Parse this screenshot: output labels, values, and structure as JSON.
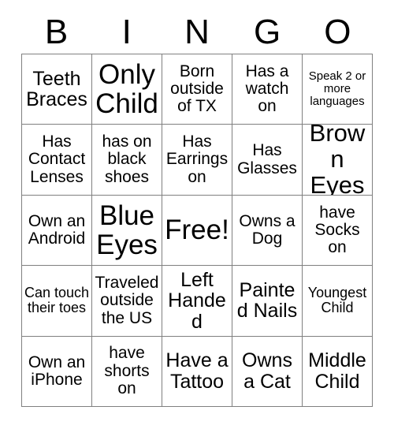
{
  "card": {
    "header_letters": [
      "B",
      "I",
      "N",
      "G",
      "O"
    ],
    "columns": 5,
    "rows": 5,
    "colors": {
      "text": "#000000",
      "grid_border": "#808080",
      "background": "#ffffff"
    },
    "cells": [
      {
        "text": "Teeth Braces",
        "size": "l",
        "row": 1,
        "col": 1
      },
      {
        "text": "Only Child",
        "size": "xxl",
        "row": 1,
        "col": 2
      },
      {
        "text": "Born outside of TX",
        "size": "m",
        "row": 1,
        "col": 3
      },
      {
        "text": "Has a watch on",
        "size": "m",
        "row": 1,
        "col": 4
      },
      {
        "text": "Speak 2 or more languages",
        "size": "xs",
        "row": 1,
        "col": 5
      },
      {
        "text": "Has Contact Lenses",
        "size": "m",
        "row": 2,
        "col": 1
      },
      {
        "text": "has on black shoes",
        "size": "m",
        "row": 2,
        "col": 2
      },
      {
        "text": "Has Earrings on",
        "size": "m",
        "row": 2,
        "col": 3
      },
      {
        "text": "Has Glasses",
        "size": "m",
        "row": 2,
        "col": 4
      },
      {
        "text": "Brown Eyes",
        "size": "xl",
        "row": 2,
        "col": 5
      },
      {
        "text": "Own an Android",
        "size": "m",
        "row": 3,
        "col": 1
      },
      {
        "text": "Blue Eyes",
        "size": "xxl",
        "row": 3,
        "col": 2
      },
      {
        "text": "Free!",
        "size": "xxl",
        "row": 3,
        "col": 3
      },
      {
        "text": "Owns a Dog",
        "size": "m",
        "row": 3,
        "col": 4
      },
      {
        "text": "have Socks on",
        "size": "m",
        "row": 3,
        "col": 5
      },
      {
        "text": "Can touch their toes",
        "size": "s",
        "row": 4,
        "col": 1
      },
      {
        "text": "Traveled outside the US",
        "size": "m",
        "row": 4,
        "col": 2
      },
      {
        "text": "Left Handed",
        "size": "l",
        "row": 4,
        "col": 3
      },
      {
        "text": "Painted Nails",
        "size": "l",
        "row": 4,
        "col": 4
      },
      {
        "text": "Youngest Child",
        "size": "s",
        "row": 4,
        "col": 5
      },
      {
        "text": "Own an iPhone",
        "size": "m",
        "row": 5,
        "col": 1
      },
      {
        "text": "have shorts on",
        "size": "m",
        "row": 5,
        "col": 2
      },
      {
        "text": "Have a Tattoo",
        "size": "l",
        "row": 5,
        "col": 3
      },
      {
        "text": "Owns a Cat",
        "size": "l",
        "row": 5,
        "col": 4
      },
      {
        "text": "Middle Child",
        "size": "l",
        "row": 5,
        "col": 5
      }
    ]
  }
}
